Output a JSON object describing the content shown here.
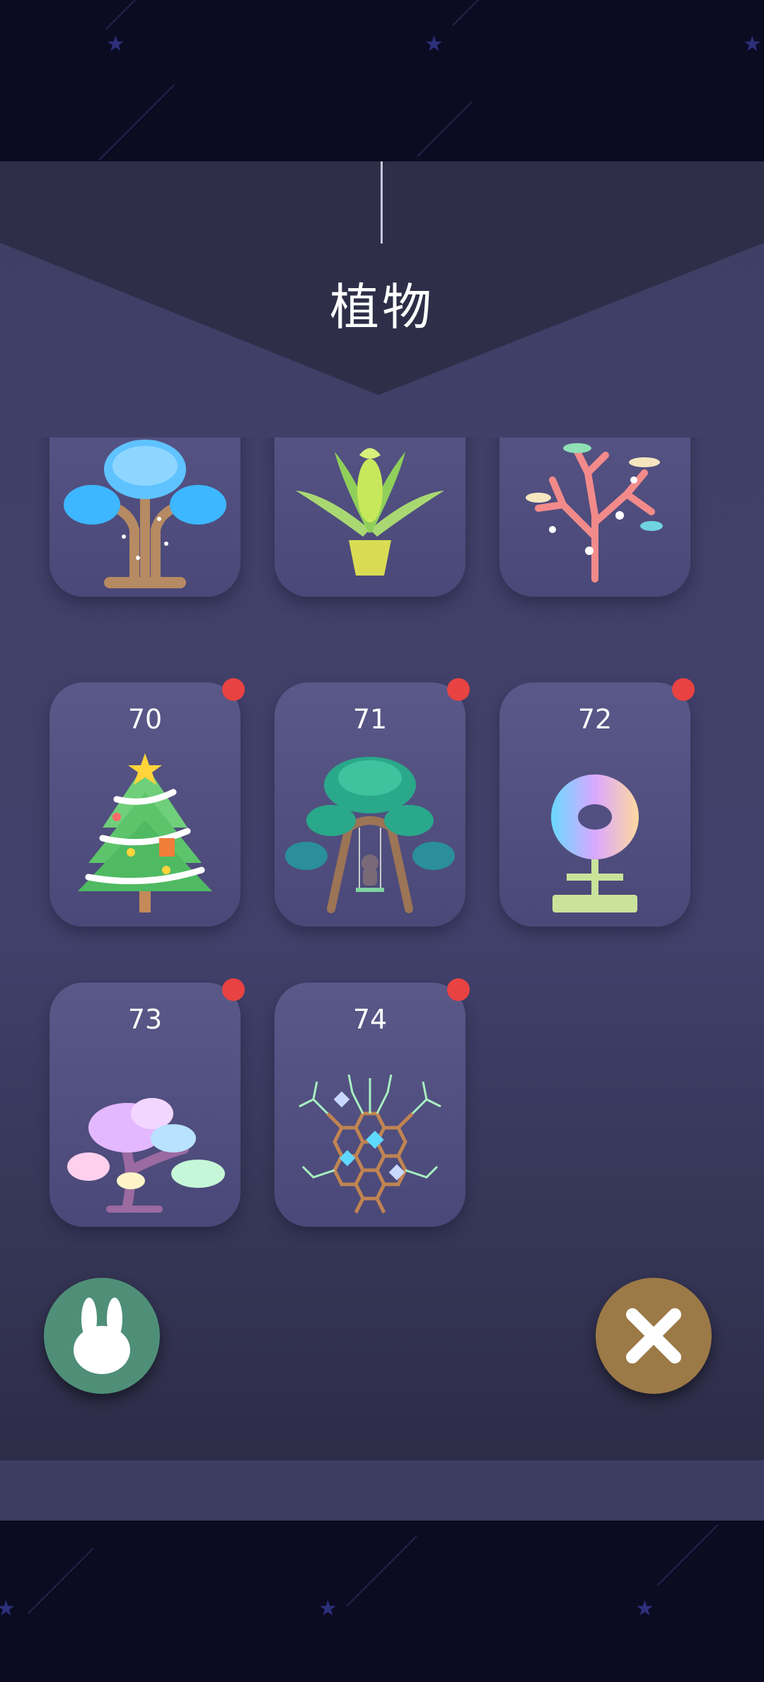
{
  "app": {
    "title": "植物"
  },
  "items": [
    {
      "number": "",
      "name": "jellyfish-tree-plant"
    },
    {
      "number": "",
      "name": "glowing-palm-plant"
    },
    {
      "number": "",
      "name": "coral-plant"
    },
    {
      "number": "70",
      "name": "christmas-tree-plant"
    },
    {
      "number": "71",
      "name": "swing-tree-plant"
    },
    {
      "number": "72",
      "name": "pixel-flower-plant"
    },
    {
      "number": "73",
      "name": "cloud-bonsai-plant"
    },
    {
      "number": "74",
      "name": "honeycomb-tree-plant"
    }
  ],
  "icons": {
    "left_button": "rabbit-icon",
    "right_button": "close-icon"
  },
  "colors": {
    "badge": "#e94242",
    "rabbit_button": "#4f8f78",
    "close_button": "#9c7a47",
    "card": "#524f82",
    "panel": "#3f3f66"
  }
}
